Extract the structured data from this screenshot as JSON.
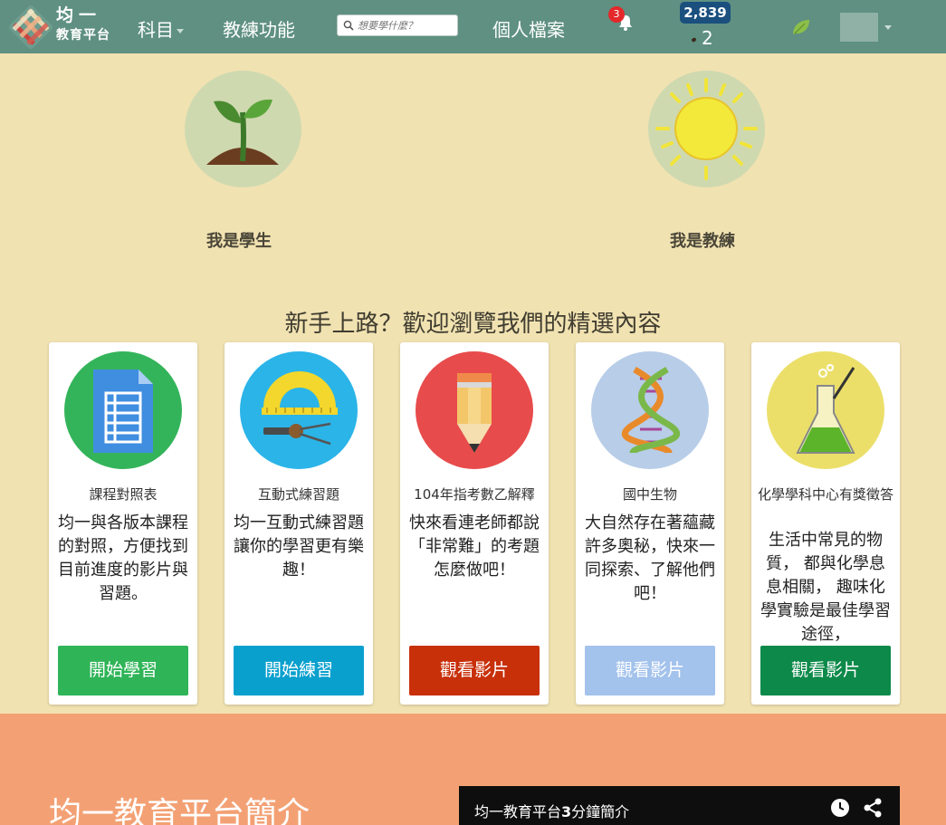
{
  "nav": {
    "logo_line1": "均一",
    "logo_line2": "教育平台",
    "subjects_label": "科目",
    "coach_label": "教練功能",
    "search_placeholder": "想要學什麼？",
    "profile_label": "個人檔案",
    "notification_count": "3",
    "points": "2,839",
    "seeds": "2"
  },
  "roles": {
    "student_label": "我是學生",
    "coach_label": "我是教練"
  },
  "featured": {
    "heading": "新手上路？歡迎瀏覽我們的精選內容",
    "cards": [
      {
        "title": "課程對照表",
        "description": "均一與各版本課程的對照，方便找到目前進度的影片與習題。",
        "button": "開始學習",
        "button_color": "#2fb457",
        "icon": "curriculum-document-icon",
        "icon_bg": "#34b45a"
      },
      {
        "title": "互動式練習題",
        "description": "均一互動式練習題讓你的學習更有樂趣！",
        "button": "開始練習",
        "button_color": "#0aa0ce",
        "icon": "ruler-compass-icon",
        "icon_bg": "#2bb4e8"
      },
      {
        "title": "104年指考數乙解釋",
        "description": "快來看連老師都說「非常難」的考題怎麼做吧！",
        "button": "觀看影片",
        "button_color": "#c8300a",
        "icon": "pencil-icon",
        "icon_bg": "#e84b4b"
      },
      {
        "title": "國中生物",
        "description": "大自然存在著蘊藏許多奧秘，快來一同探索、了解他們吧！",
        "button": "觀看影片",
        "button_color": "#a3c2ec",
        "icon": "dna-icon",
        "icon_bg": "#b8cde8"
      },
      {
        "title": "化學學科中心有獎徵答",
        "description": "生活中常見的物質， 都與化學息息相關， 趣味化學實驗是最佳學習途徑，",
        "button": "觀看影片",
        "button_color": "#0d8a4a",
        "icon": "flask-icon",
        "icon_bg": "#ebdf6a"
      }
    ]
  },
  "intro": {
    "title": "均一教育平台簡介",
    "video_title_prefix": "均一教育平台",
    "video_title_bold": "3",
    "video_title_suffix": "分鐘簡介"
  }
}
